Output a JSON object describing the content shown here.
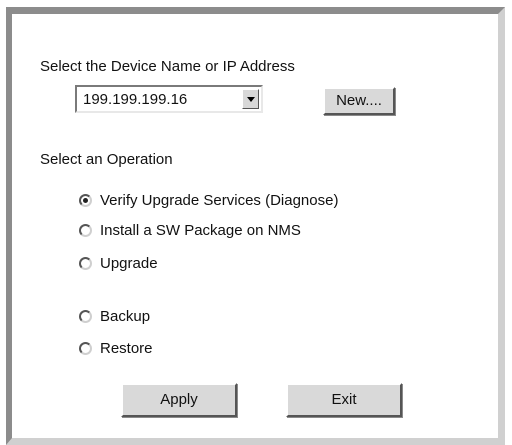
{
  "device": {
    "heading": "Select the Device Name or IP Address",
    "selected_value": "199.199.199.16",
    "new_button_label": "New...."
  },
  "operation": {
    "heading": "Select an Operation",
    "options": [
      {
        "label": "Verify Upgrade Services (Diagnose)",
        "checked": true
      },
      {
        "label": "Install a SW Package on NMS",
        "checked": false
      },
      {
        "label": "Upgrade",
        "checked": false
      },
      {
        "label": "Backup",
        "checked": false
      },
      {
        "label": "Restore",
        "checked": false
      }
    ]
  },
  "actions": {
    "apply_label": "Apply",
    "exit_label": "Exit"
  }
}
